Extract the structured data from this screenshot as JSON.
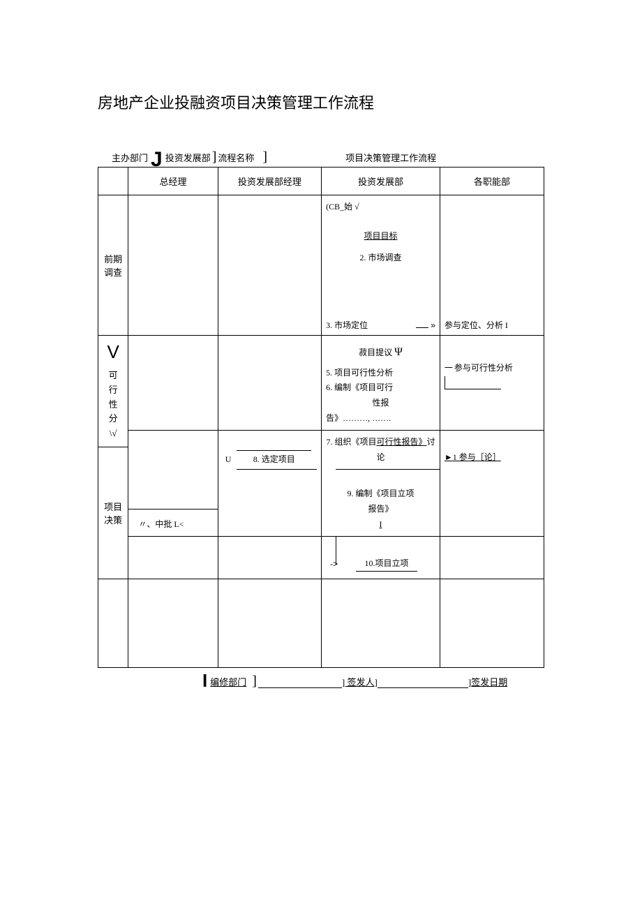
{
  "title": "房地产企业投融资项目决策管理工作流程",
  "header": {
    "host_label": "主办部门",
    "host_value": "投资发展部",
    "flow_label": "流程名称",
    "flow_value": "项目决策管理工作流程"
  },
  "columns": {
    "stage": "",
    "gm": "总经理",
    "mgr": "投资发展部经理",
    "dept": "投资发展部",
    "func": "各职能部"
  },
  "stages": {
    "s1": "前期调查",
    "s2_marker": "V",
    "s2_lines": [
      "可",
      "行",
      "性",
      "分",
      "\\√"
    ],
    "s3": "项目决策"
  },
  "cells": {
    "r1_dept_start": "(CB_始 √",
    "r1_dept_goal": "项目目标",
    "r1_dept_survey": "2. 市场调查",
    "r1_dept_position": "3. 市场定位",
    "r1_dept_arrow": "»",
    "r1_func": "参与定位、分析 I",
    "r2_dept_suggest": "菽目提议",
    "r2_dept_psi": "Ψ",
    "r2_dept_5": "5. 项目可行性分析",
    "r2_dept_6a": "6. 编制《项目可行",
    "r2_dept_6b": "性报",
    "r2_dept_6c": "告》………, …….",
    "r2_func_dash": "一",
    "r2_func": "参与可行性分析",
    "r3_mgr_u": "U",
    "r3_mgr_8": "8. 选定项目",
    "r3_dept_7a": "7. 组织《项目",
    "r3_dept_7b": "可行性报告》",
    "r3_dept_7c": "讨论",
    "r3_dept_9a": "9. 编制《项目立项",
    "r3_dept_9b": "报告》",
    "r3_dept_9c": "I",
    "r3_func_arrow": "►",
    "r3_func": "1 参与［论］",
    "r3_gm": "〃、中批 L<",
    "r4_dept_arrow": "->",
    "r4_dept_10": "10.项目立项"
  },
  "footer": {
    "edit_label": "编修部门",
    "signer_label": "签发人",
    "date_label": "签发日期"
  }
}
